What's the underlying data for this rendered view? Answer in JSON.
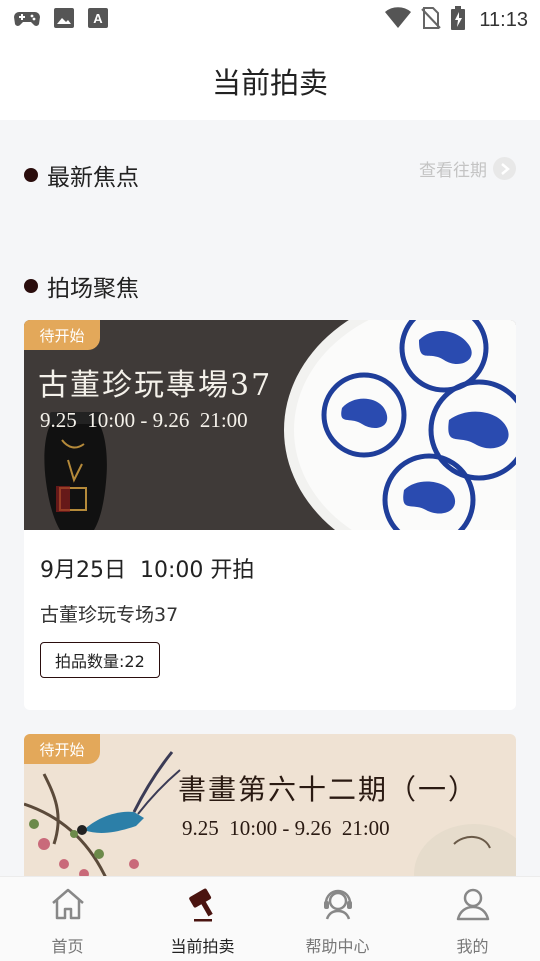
{
  "status_bar": {
    "time": "11:13"
  },
  "header": {
    "title": "当前拍卖"
  },
  "focus": {
    "title": "最新焦点",
    "more_label": "查看往期"
  },
  "auction_focus": {
    "title": "拍场聚焦"
  },
  "cards": [
    {
      "badge": "待开始",
      "banner_title": "古董珍玩專場37",
      "banner_date": "9.25  10:00 - 9.26  21:00",
      "start_time": "9月25日  10:00 开拍",
      "name": "古董珍玩专场37",
      "count": "拍品数量:22"
    },
    {
      "badge": "待开始",
      "banner_title": "書畫第六十二期（一）",
      "banner_date": "9.25  10:00 - 9.26  21:00"
    }
  ],
  "tabbar": {
    "items": [
      {
        "label": "首页",
        "icon": "home-icon"
      },
      {
        "label": "当前拍卖",
        "icon": "gavel-icon"
      },
      {
        "label": "帮助中心",
        "icon": "headset-icon"
      },
      {
        "label": "我的",
        "icon": "user-icon"
      }
    ],
    "active_index": 1
  },
  "colors": {
    "accent": "#2a0d0d",
    "badge": "#e3a85a",
    "background": "#f5f6f8"
  }
}
